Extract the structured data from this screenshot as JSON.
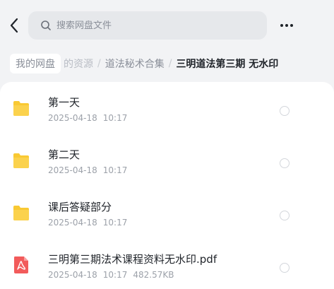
{
  "search": {
    "placeholder": "搜索网盘文件"
  },
  "breadcrumb": {
    "root": "我的网盘",
    "partial": "的资源",
    "middle": "道法秘术合集",
    "current": "三明道法第三期 无水印"
  },
  "files": [
    {
      "name": "第一天",
      "date": "2025-04-18",
      "time": "10:17",
      "size": "",
      "type": "folder",
      "icon": "folder-icon"
    },
    {
      "name": "第二天",
      "date": "2025-04-18",
      "time": "10:17",
      "size": "",
      "type": "folder",
      "icon": "folder-icon"
    },
    {
      "name": "课后答疑部分",
      "date": "2025-04-18",
      "time": "10:17",
      "size": "",
      "type": "folder",
      "icon": "folder-icon"
    },
    {
      "name": "三明第三期法术课程资料无水印.pdf",
      "date": "2025-04-18",
      "time": "10:17",
      "size": "482.57KB",
      "type": "pdf",
      "icon": "pdf-icon"
    }
  ],
  "colors": {
    "folder": "#f9c933",
    "pdf": "#f25b5b",
    "background": "#f2f3f5"
  }
}
